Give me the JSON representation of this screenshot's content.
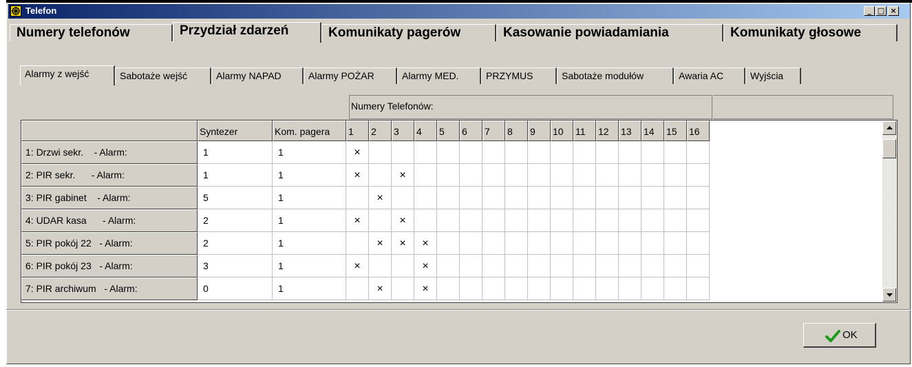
{
  "window": {
    "title": "Telefon",
    "btn_min": "_",
    "btn_max": "□",
    "btn_close": "×"
  },
  "main_tabs": [
    "Numery telefonów",
    "Przydział zdarzeń",
    "Komunikaty pagerów",
    "Kasowanie powiadamiania",
    "Komunikaty głosowe"
  ],
  "main_tab_active": "Przydział zdarzeń",
  "sub_tabs": [
    "Alarmy z wejść",
    "Sabotaże wejść",
    "Alarmy NAPAD",
    "Alarmy POŻAR",
    "Alarmy MED.",
    "PRZYMUS",
    "Sabotaże modułów",
    "Awaria AC",
    "Wyjścia"
  ],
  "sub_tab_active": "Alarmy z wejść",
  "group_label": "Numery Telefonów:",
  "columns": [
    "Syntezer",
    "Kom. pagera",
    "1",
    "2",
    "3",
    "4",
    "5",
    "6",
    "7",
    "8",
    "9",
    "10",
    "11",
    "12",
    "13",
    "14",
    "15",
    "16"
  ],
  "rows": [
    {
      "label": "1: Drzwi sekr.    - Alarm:",
      "syntezer": "1",
      "pager": "1",
      "phones": [
        true,
        false,
        false,
        false,
        false,
        false,
        false,
        false,
        false,
        false,
        false,
        false,
        false,
        false,
        false,
        false
      ]
    },
    {
      "label": "2: PIR sekr.      - Alarm:",
      "syntezer": "1",
      "pager": "1",
      "phones": [
        true,
        false,
        true,
        false,
        false,
        false,
        false,
        false,
        false,
        false,
        false,
        false,
        false,
        false,
        false,
        false
      ]
    },
    {
      "label": "3: PIR gabinet    - Alarm:",
      "syntezer": "5",
      "pager": "1",
      "phones": [
        false,
        true,
        false,
        false,
        false,
        false,
        false,
        false,
        false,
        false,
        false,
        false,
        false,
        false,
        false,
        false
      ]
    },
    {
      "label": "4: UDAR kasa      - Alarm:",
      "syntezer": "2",
      "pager": "1",
      "phones": [
        true,
        false,
        true,
        false,
        false,
        false,
        false,
        false,
        false,
        false,
        false,
        false,
        false,
        false,
        false,
        false
      ]
    },
    {
      "label": "5: PIR pokój 22   - Alarm:",
      "syntezer": "2",
      "pager": "1",
      "phones": [
        false,
        true,
        true,
        true,
        false,
        false,
        false,
        false,
        false,
        false,
        false,
        false,
        false,
        false,
        false,
        false
      ]
    },
    {
      "label": "6: PIR pokój 23   - Alarm:",
      "syntezer": "3",
      "pager": "1",
      "phones": [
        true,
        false,
        false,
        true,
        false,
        false,
        false,
        false,
        false,
        false,
        false,
        false,
        false,
        false,
        false,
        false
      ]
    },
    {
      "label": "7: PIR archiwum   - Alarm:",
      "syntezer": "0",
      "pager": "1",
      "phones": [
        false,
        true,
        false,
        true,
        false,
        false,
        false,
        false,
        false,
        false,
        false,
        false,
        false,
        false,
        false,
        false
      ]
    }
  ],
  "check_mark": "×",
  "ok_label": "OK",
  "colors": {
    "titlebar_start": "#0a246a",
    "titlebar_end": "#a6caf0",
    "face": "#d4d0c8",
    "ok_check": "#1a9c1a"
  }
}
